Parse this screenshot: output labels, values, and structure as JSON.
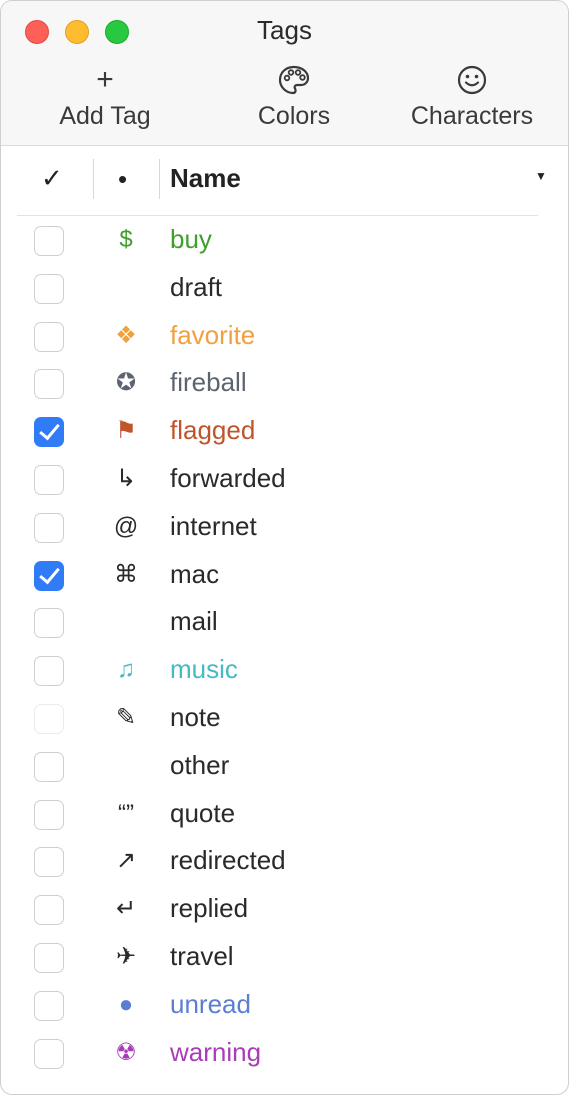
{
  "window": {
    "title": "Tags"
  },
  "toolbar": {
    "add_icon": "+",
    "add_label": "Add Tag",
    "colors_icon": "🎨",
    "colors_label": "Colors",
    "characters_icon": "☺",
    "characters_label": "Characters"
  },
  "table": {
    "header_check": "✓",
    "header_dot": "•",
    "header_name": "Name",
    "sort_indicator": "▼"
  },
  "tags": [
    {
      "name": "buy",
      "symbol": "$",
      "color": "#3e9f2a",
      "checked": false,
      "icon": "dollar-icon"
    },
    {
      "name": "draft",
      "symbol": "",
      "color": "#2a2a2a",
      "checked": false,
      "icon": "none"
    },
    {
      "name": "favorite",
      "symbol": "❖",
      "color": "#f2a03e",
      "checked": false,
      "icon": "diamond-icon"
    },
    {
      "name": "fireball",
      "symbol": "✪",
      "color": "#5d6470",
      "checked": false,
      "icon": "star-circle-icon"
    },
    {
      "name": "flagged",
      "symbol": "⚑",
      "color": "#c0552c",
      "checked": true,
      "icon": "flag-icon"
    },
    {
      "name": "forwarded",
      "symbol": "↳",
      "color": "#2a2a2a",
      "checked": false,
      "icon": "forward-arrow-icon"
    },
    {
      "name": "internet",
      "symbol": "@",
      "color": "#2a2a2a",
      "checked": false,
      "icon": "at-icon"
    },
    {
      "name": "mac",
      "symbol": "⌘",
      "color": "#2a2a2a",
      "checked": true,
      "icon": "command-icon"
    },
    {
      "name": "mail",
      "symbol": "",
      "color": "#2a2a2a",
      "checked": false,
      "icon": "none"
    },
    {
      "name": "music",
      "symbol": "♫",
      "color": "#45b9c4",
      "checked": false,
      "icon": "music-note-icon"
    },
    {
      "name": "note",
      "symbol": "✎",
      "color": "#2a2a2a",
      "checked": false,
      "icon": "pencil-icon"
    },
    {
      "name": "other",
      "symbol": "",
      "color": "#2a2a2a",
      "checked": false,
      "icon": "none"
    },
    {
      "name": "quote",
      "symbol": "“”",
      "color": "#2a2a2a",
      "checked": false,
      "icon": "quote-icon"
    },
    {
      "name": "redirected",
      "symbol": "↗",
      "color": "#2a2a2a",
      "checked": false,
      "icon": "redirect-arrow-icon"
    },
    {
      "name": "replied",
      "symbol": "↵",
      "color": "#2a2a2a",
      "checked": false,
      "icon": "reply-arrow-icon"
    },
    {
      "name": "travel",
      "symbol": "✈",
      "color": "#2a2a2a",
      "checked": false,
      "icon": "airplane-icon"
    },
    {
      "name": "unread",
      "symbol": "●",
      "color": "#5b7fd0",
      "checked": false,
      "icon": "dot-icon"
    },
    {
      "name": "warning",
      "symbol": "☢",
      "color": "#a83db7",
      "checked": false,
      "icon": "radioactive-icon"
    }
  ]
}
